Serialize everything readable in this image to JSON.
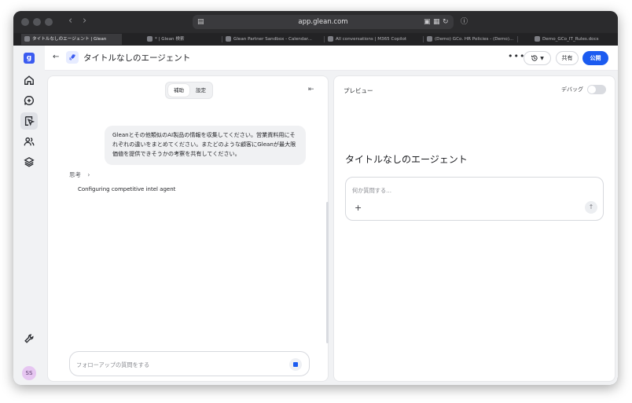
{
  "browser": {
    "url": "app.glean.com",
    "tabs": [
      {
        "label": "タイトルなしのエージェント | Glean",
        "active": true
      },
      {
        "label": "* | Glean 検索",
        "active": false
      },
      {
        "label": "Glean Partner Sandbox - Calendar...",
        "active": false
      },
      {
        "label": "All conversations | M365 Copilot",
        "active": false
      },
      {
        "label": "(Demo) GCo. HR Policies - (Demo)...",
        "active": false
      },
      {
        "label": "Demo_GCo_IT_Rules.docs",
        "active": false
      }
    ]
  },
  "sidebar": {
    "logo": "g",
    "items": [
      {
        "name": "home",
        "icon": "home-icon"
      },
      {
        "name": "new-chat",
        "icon": "chat-plus-icon"
      },
      {
        "name": "agents",
        "icon": "agent-icon",
        "active": true
      },
      {
        "name": "people",
        "icon": "people-icon"
      },
      {
        "name": "library",
        "icon": "layers-icon"
      }
    ],
    "settings_icon": "wrench-icon",
    "avatar_initials": "SS",
    "brand": "glean"
  },
  "header": {
    "back_icon": "←",
    "title": "タイトルなしのエージェント",
    "more": "•••",
    "history_icon": "history-icon",
    "share_label": "共有",
    "publish_label": "公開"
  },
  "builder": {
    "tabs": [
      {
        "label": "補助",
        "active": true
      },
      {
        "label": "設定",
        "active": false
      }
    ],
    "user_message": "Gleanとその他類似のAI製品の情報を収集してください。営業資料用にそれぞれの違いをまとめてください。またどのような顧客にGleanが最大限価値を提供できそうかの考察を共有してください。",
    "thinking_label": "思考",
    "step_text": "Configuring competitive intel agent",
    "followup_placeholder": "フォローアップの質問をする"
  },
  "preview": {
    "label": "プレビュー",
    "debug_label": "デバッグ",
    "debug_on": false,
    "agent_title": "タイトルなしのエージェント",
    "input_placeholder": "何か質問する...",
    "plus": "+",
    "send": "↑"
  },
  "colors": {
    "accent": "#1b5bf0",
    "logo": "#3b5bf0",
    "avatar": "#e6c6f1"
  }
}
